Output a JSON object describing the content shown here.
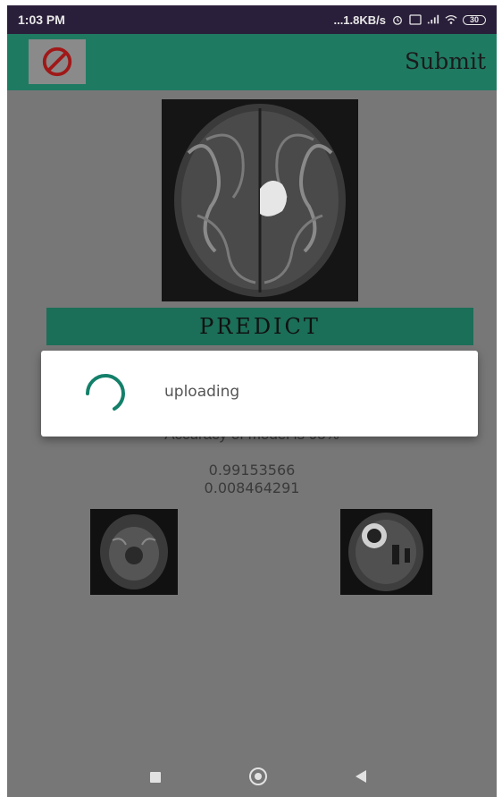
{
  "status_bar": {
    "time": "1:03 PM",
    "network_speed": "...1.8KB/s",
    "battery": "30",
    "icons": [
      "alarm-icon",
      "volte-icon",
      "signal-icon",
      "wifi-icon",
      "battery-icon"
    ]
  },
  "app_bar": {
    "left_icon": "prohibited-icon",
    "submit_label": "Submit",
    "colors": {
      "app_bar": "#1f7a62",
      "block_icon": "#a01818"
    }
  },
  "main": {
    "predict_label": "PREDICT",
    "accuracy_text": "Accuracy of model is 95%",
    "values": [
      "0.99153566",
      "0.008464291"
    ]
  },
  "dialog": {
    "message": "uploading",
    "spinner_color": "#14806a"
  },
  "nav": {
    "icons": [
      "recent-apps-icon",
      "home-icon",
      "back-icon"
    ]
  }
}
